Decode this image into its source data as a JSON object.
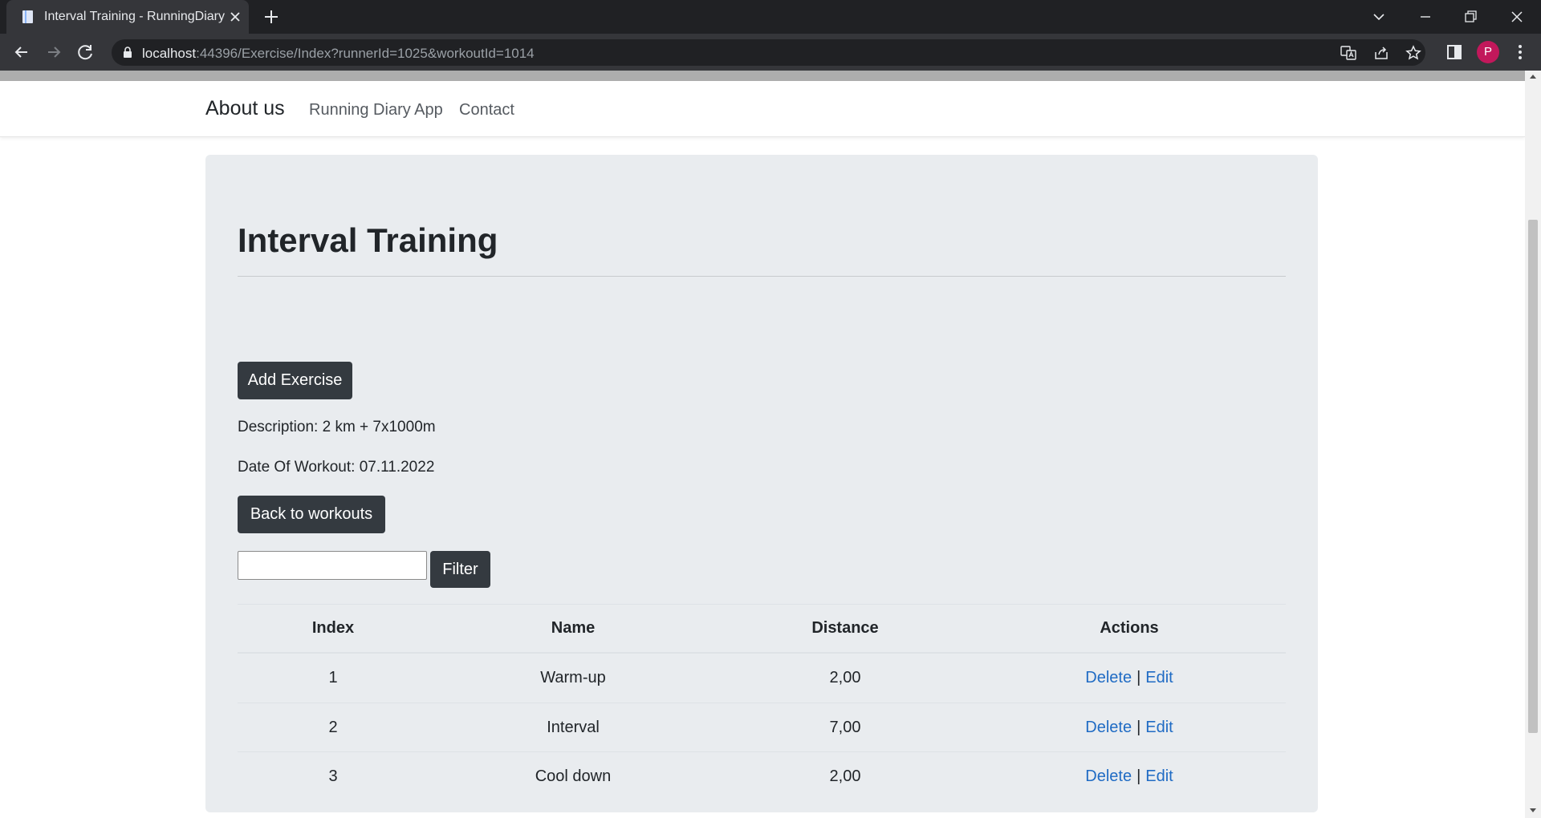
{
  "browser": {
    "tab_title": "Interval Training - RunningDiary",
    "url_host": "localhost",
    "url_rest": ":44396/Exercise/Index?runnerId=1025&workoutId=1014",
    "profile_initial": "P"
  },
  "navbar": {
    "brand": "About us",
    "links": [
      "Running Diary App",
      "Contact"
    ]
  },
  "workout": {
    "title": "Interval Training",
    "add_button": "Add Exercise",
    "description": "Description: 2 km + 7x1000m",
    "date": "Date Of Workout: 07.11.2022",
    "back_button": "Back to workouts"
  },
  "filter": {
    "value": "",
    "button": "Filter"
  },
  "table": {
    "headers": [
      "Index",
      "Name",
      "Distance",
      "Actions"
    ],
    "rows": [
      {
        "index": "1",
        "name": "Warm-up",
        "distance": "2,00"
      },
      {
        "index": "2",
        "name": "Interval",
        "distance": "7,00"
      },
      {
        "index": "3",
        "name": "Cool down",
        "distance": "2,00"
      }
    ],
    "action_delete": "Delete",
    "action_separator": "|",
    "action_edit": "Edit"
  },
  "colors": {
    "chrome_dark": "#202124",
    "chrome_toolbar": "#35363a",
    "jumbotron": "#e9ecef",
    "button_dark": "#343a40",
    "link": "#1f6bc4",
    "avatar": "#c2185b"
  },
  "icons": [
    "page-favicon-icon",
    "close-icon",
    "plus-icon",
    "chevron-down-icon",
    "minimize-icon",
    "restore-icon",
    "back-arrow-icon",
    "forward-arrow-icon",
    "reload-icon",
    "lock-icon",
    "translate-icon",
    "share-icon",
    "star-icon",
    "side-panel-icon",
    "kebab-menu-icon"
  ]
}
